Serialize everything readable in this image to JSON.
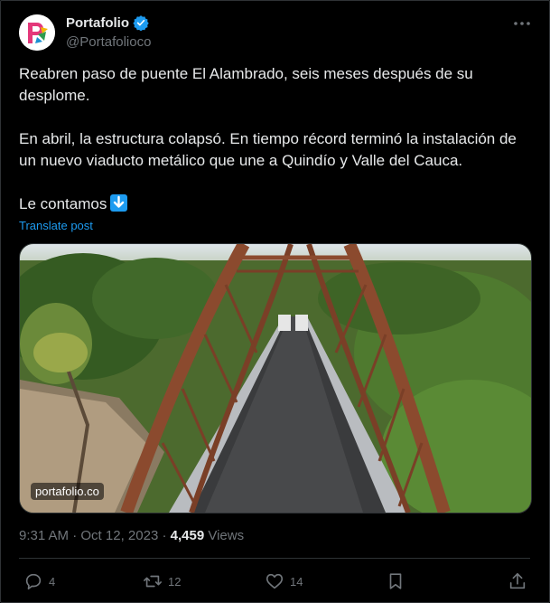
{
  "author": {
    "display_name": "Portafolio",
    "handle": "@Portafolioco",
    "avatar_icon": "portafolio-logo",
    "verified_icon": "verified-badge-icon"
  },
  "tweet": {
    "line1": "Reabren paso de puente El Alambrado, seis meses después de su desplome.",
    "line2": "En abril, la estructura colapsó. En tiempo récord terminó la instalación de un nuevo viaducto metálico que une a Quindío y Valle del Cauca.",
    "line3": "Le contamos",
    "translate_label": "Translate post",
    "media_watermark": "portafolio.co"
  },
  "meta": {
    "time": "9:31 AM",
    "date": "Oct 12, 2023",
    "views_count": "4,459",
    "views_label": "Views"
  },
  "actions": {
    "replies": "4",
    "reposts": "12",
    "likes": "14"
  },
  "colors": {
    "background": "#000000",
    "text": "#e7e9ea",
    "muted": "#71767b",
    "accent": "#1d9bf0",
    "border": "#2f3336"
  }
}
